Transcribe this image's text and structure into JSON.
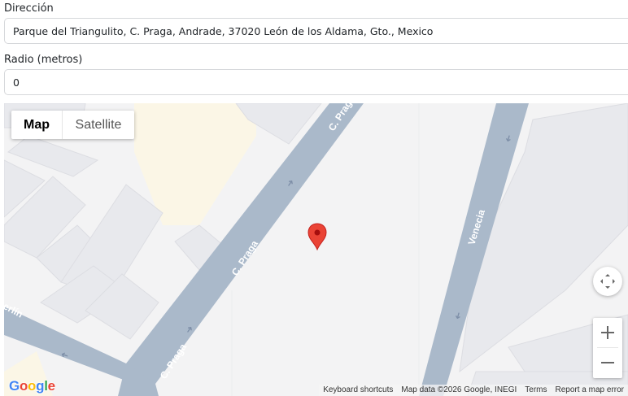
{
  "form": {
    "address_label": "Dirección",
    "address_value": "Parque del Triangulito, C. Praga, Andrade, 37020 León de los Aldama, Gto., Mexico",
    "radius_label": "Radio (metros)",
    "radius_value": "0"
  },
  "map": {
    "type_controls": {
      "map": "Map",
      "satellite": "Satellite",
      "selected": "Map"
    },
    "streets": [
      {
        "name": "C. Praga"
      },
      {
        "name": "C. Praga"
      },
      {
        "name": "C. Praga"
      },
      {
        "name": "Venecia"
      },
      {
        "name": "erlín"
      }
    ],
    "logo": "Google",
    "logo_colors": [
      "#4285F4",
      "#EA4335",
      "#FBBC05",
      "#4285F4",
      "#34A853",
      "#EA4335"
    ],
    "attribution": {
      "shortcuts": "Keyboard shortcuts",
      "data": "Map data ©2026 Google, INEGI",
      "terms": "Terms",
      "report": "Report a map error"
    },
    "marker_color": "#EA4335",
    "road_color": "#aab9ca"
  },
  "icons": {
    "rotate": "camera-control-icon",
    "zoom_in": "plus-icon",
    "zoom_out": "minus-icon",
    "marker": "map-pin-icon"
  }
}
